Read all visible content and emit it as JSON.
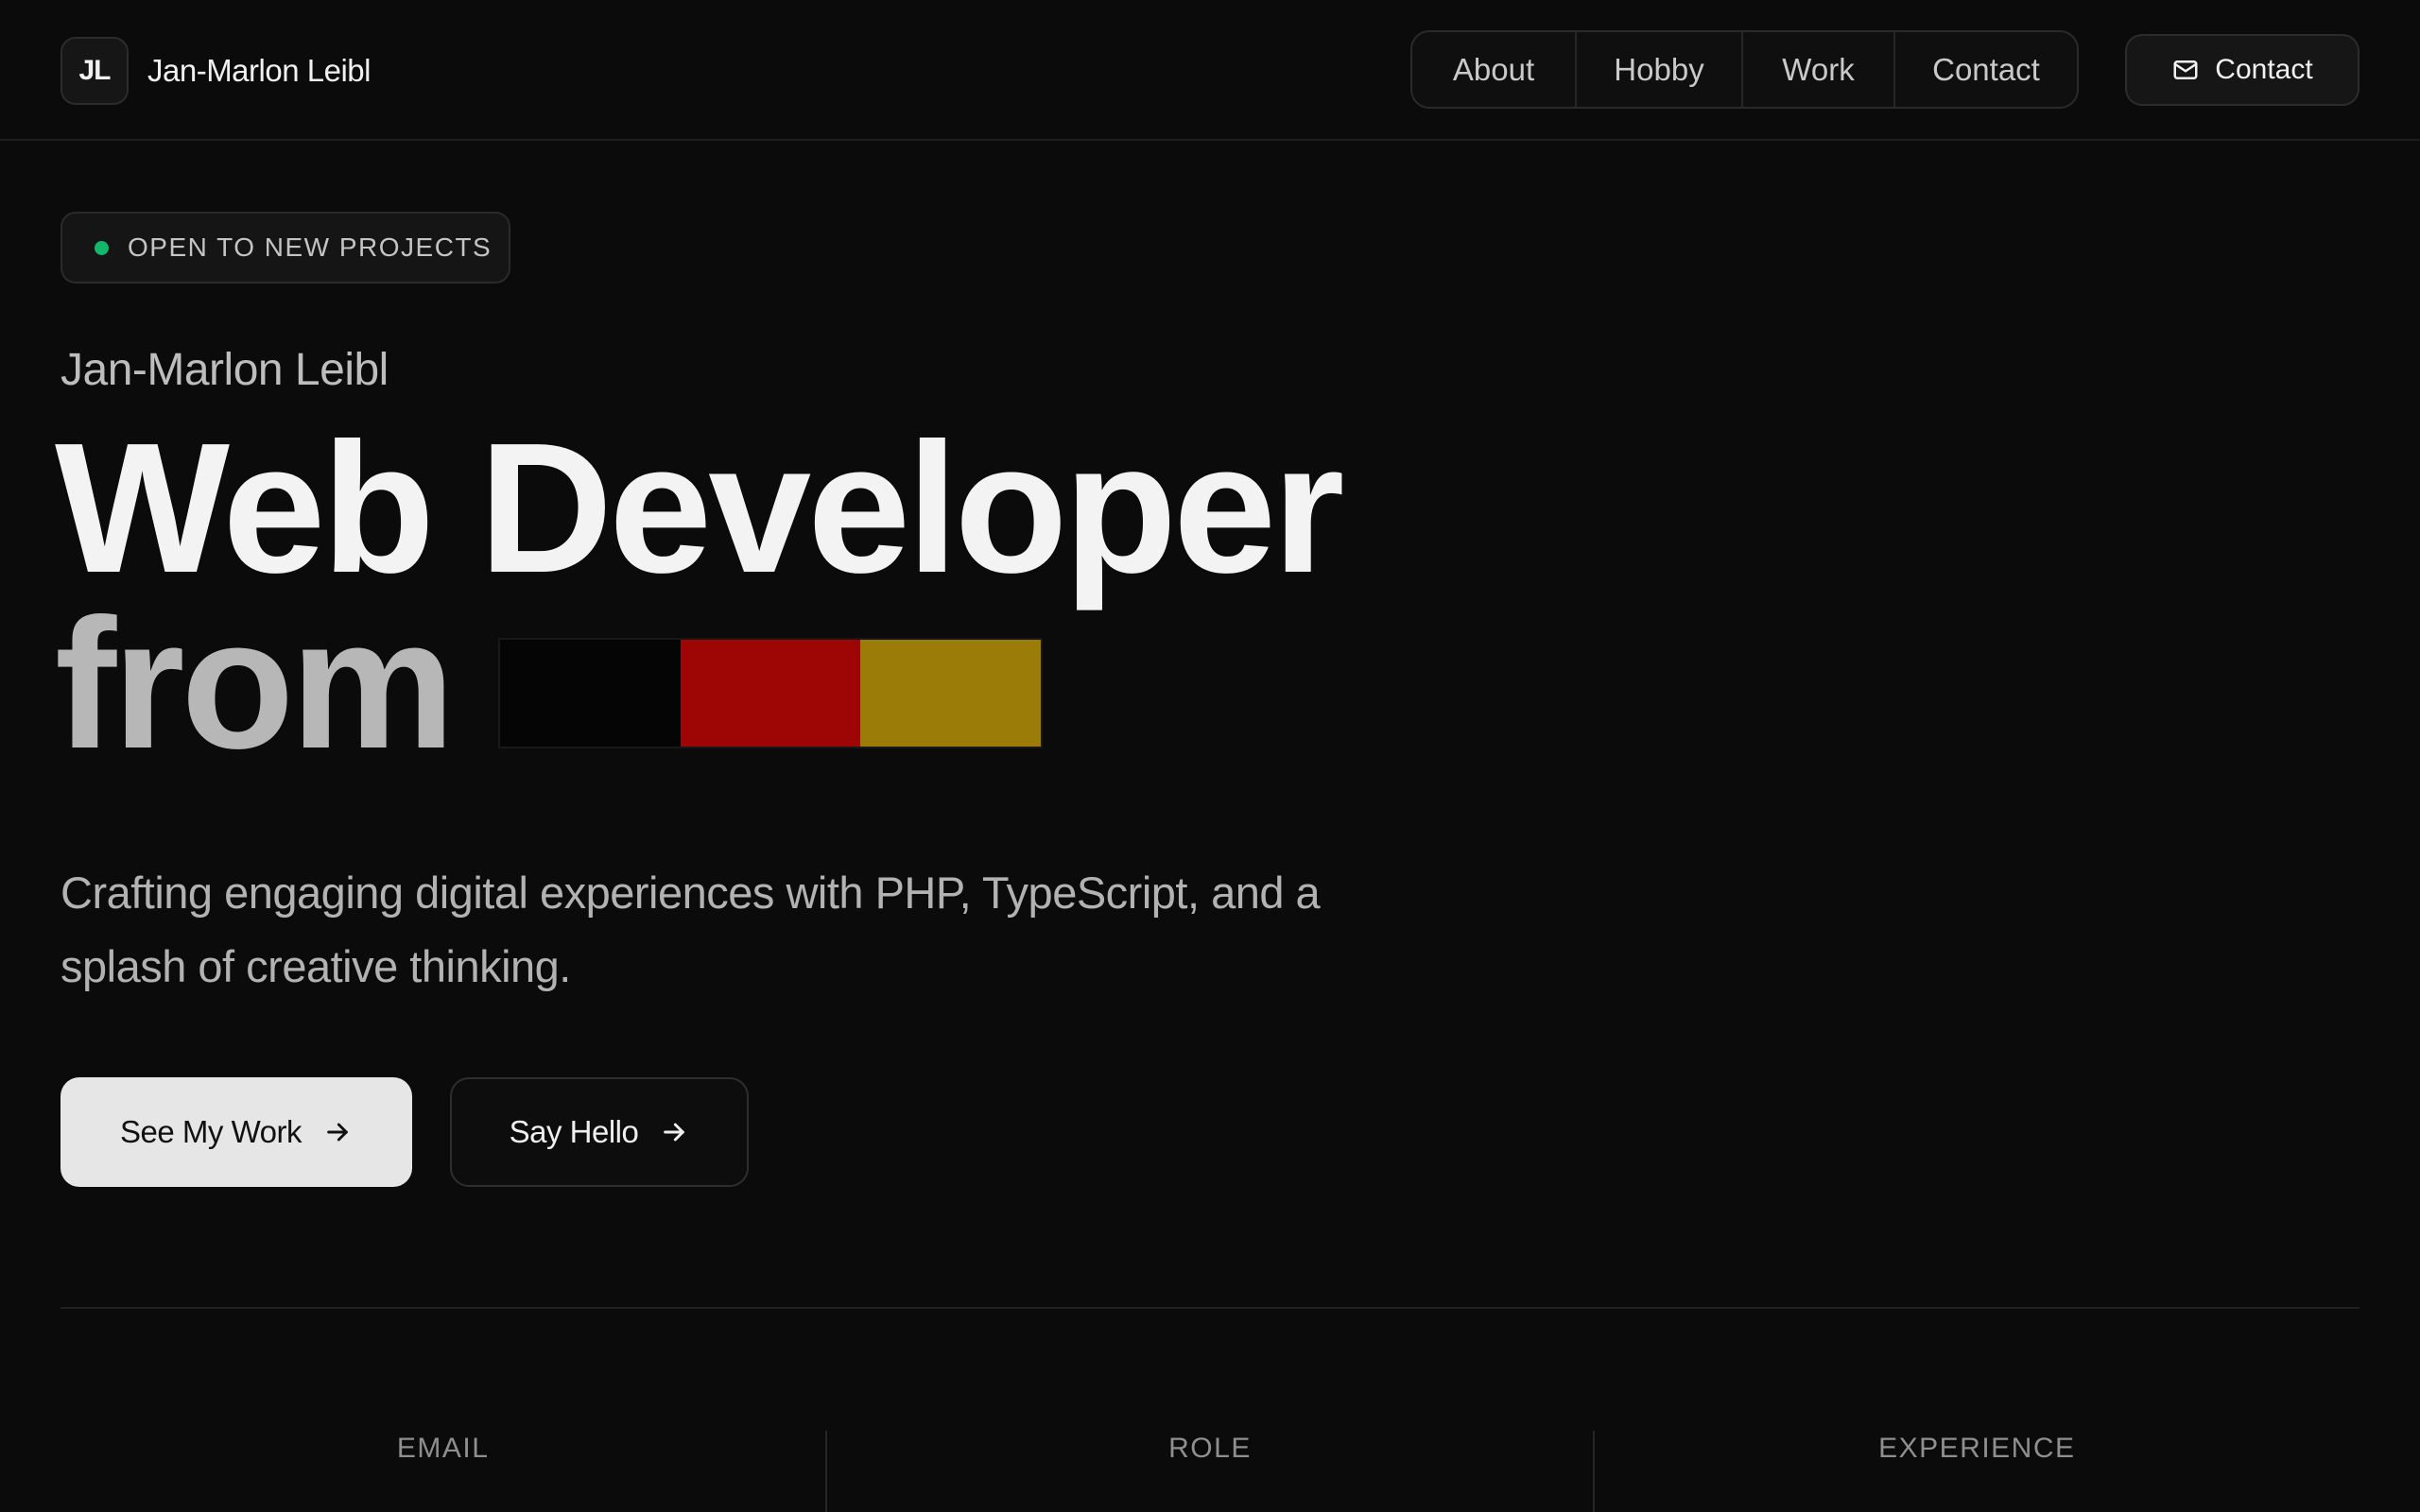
{
  "header": {
    "logo_initials": "JL",
    "brand_name": "Jan-Marlon Leibl",
    "nav": {
      "about": "About",
      "hobby": "Hobby",
      "work": "Work",
      "contact": "Contact"
    },
    "contact_button": "Contact",
    "contact_button_icon": "mail-icon"
  },
  "hero": {
    "badge": "OPEN TO NEW PROJECTS",
    "badge_dot_color": "#12b76a",
    "eyebrow": "Jan-Marlon Leibl",
    "headline_line1": "Web Developer",
    "headline_line2": "from",
    "flag_colors": [
      "#050505",
      "#9e0505",
      "#9c7c08"
    ],
    "tagline": "Crafting engaging digital experiences with PHP, TypeScript, and a splash of creative thinking.",
    "primary_button": "See My Work",
    "secondary_button": "Say Hello",
    "button_icon": "arrow-right-icon"
  },
  "stats": {
    "email_label": "EMAIL",
    "role_label": "ROLE",
    "experience_label": "EXPERIENCE"
  }
}
